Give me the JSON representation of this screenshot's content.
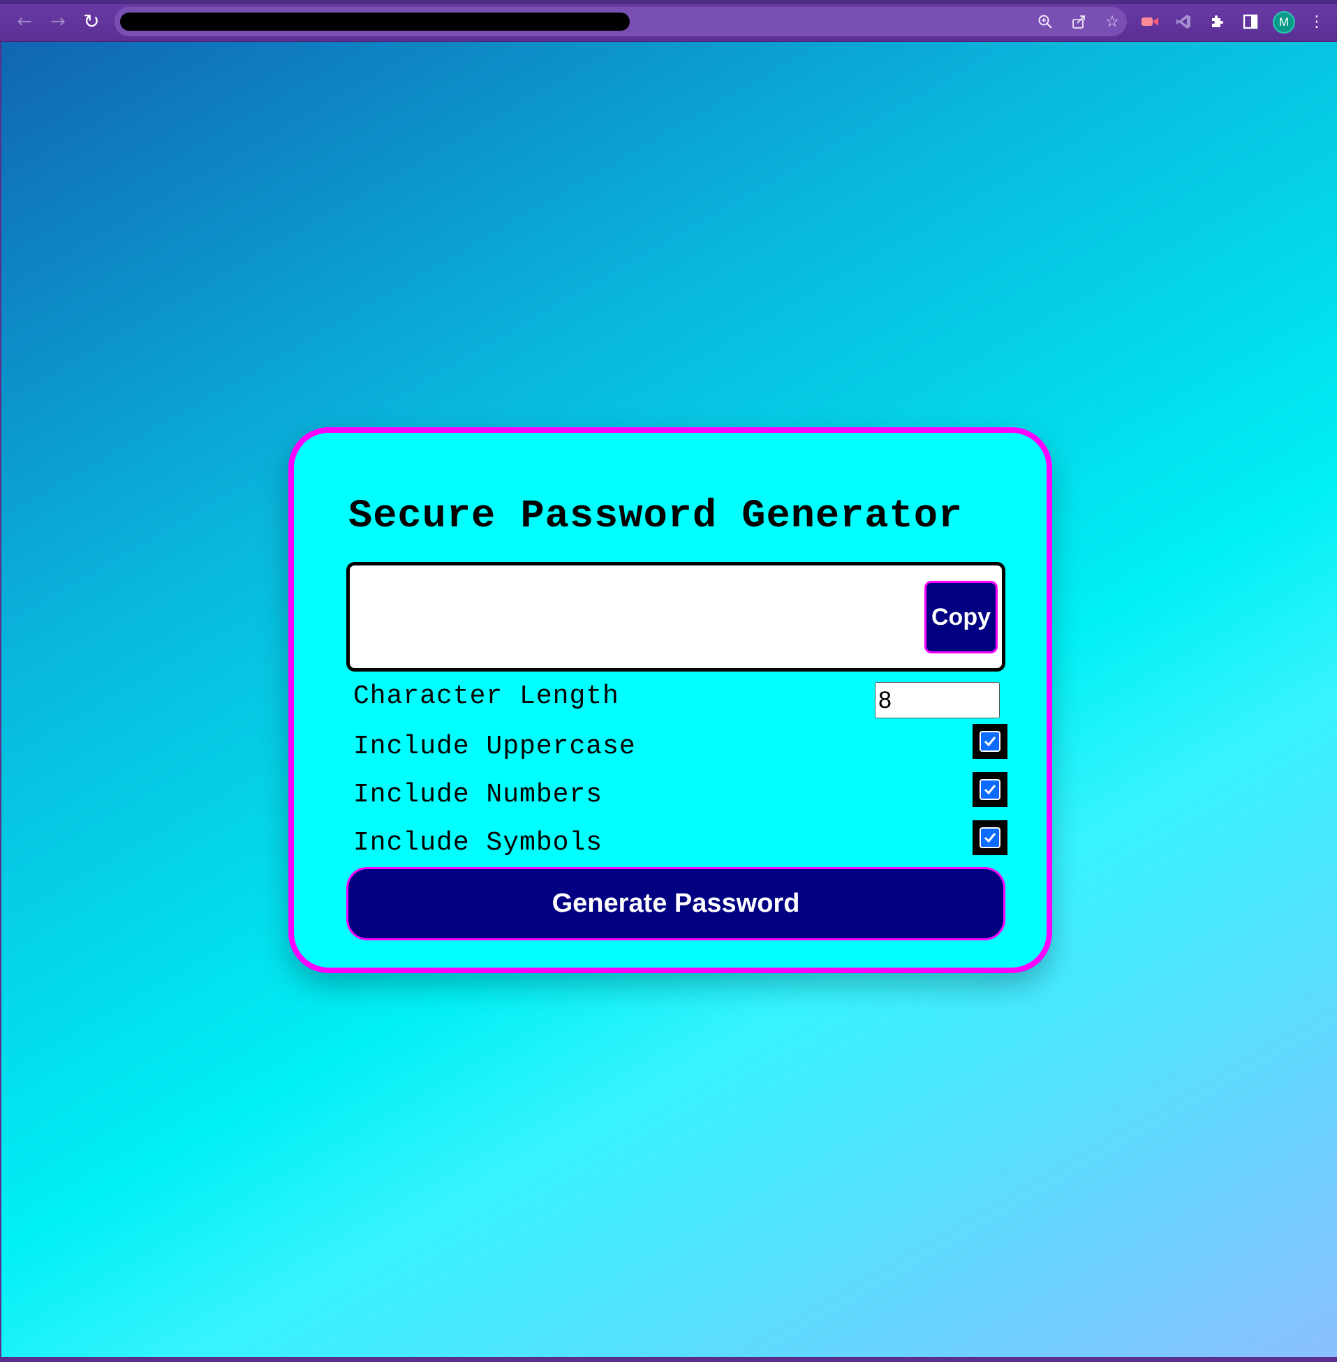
{
  "browser": {
    "url": "",
    "nav_icons": {
      "back": "back-arrow-icon",
      "forward": "forward-arrow-icon",
      "reload": "reload-icon"
    },
    "avatar_initial": "M"
  },
  "app": {
    "title": "Secure Password Generator",
    "result": {
      "value": "",
      "copy_label": "Copy"
    },
    "settings": {
      "length": {
        "label": "Character Length",
        "value": "8"
      },
      "uppercase": {
        "label": "Include Uppercase",
        "checked": true
      },
      "numbers": {
        "label": "Include Numbers",
        "checked": true
      },
      "symbols": {
        "label": "Include Symbols",
        "checked": true
      }
    },
    "generate_label": "Generate Password"
  },
  "colors": {
    "card_bg": "#00ffff",
    "card_border": "#ff00ff",
    "button_bg": "#000080",
    "checkbox_accent": "#0b6cff"
  }
}
